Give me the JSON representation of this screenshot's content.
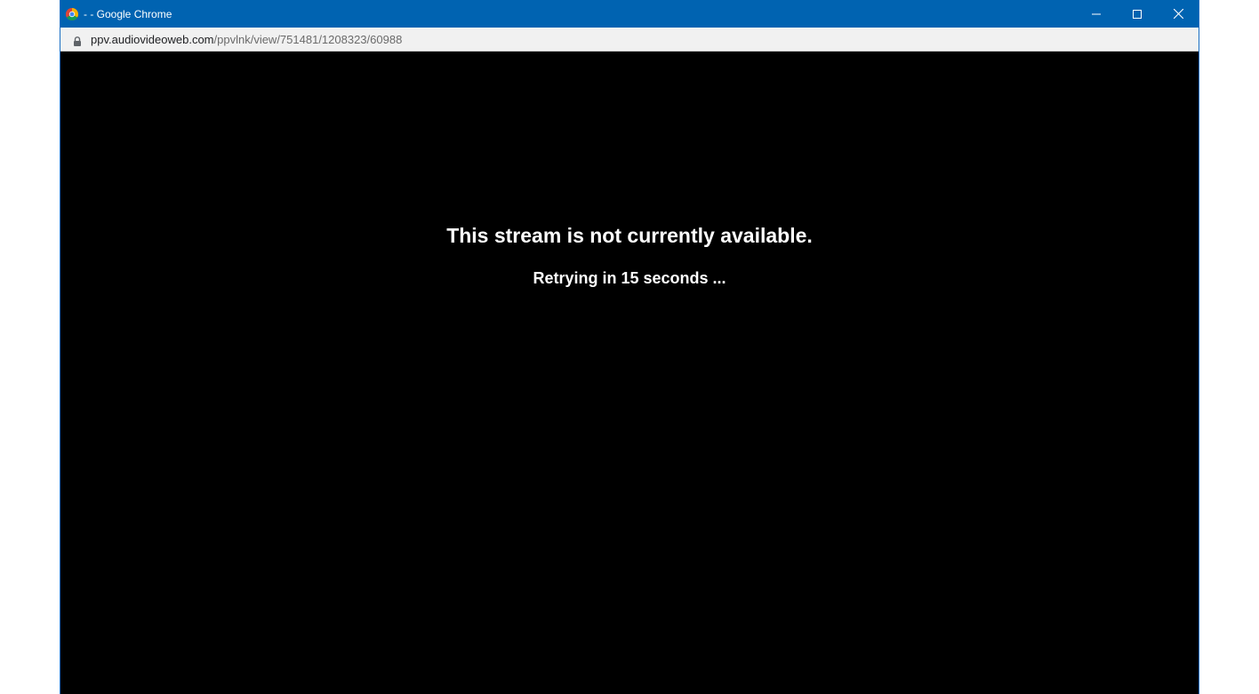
{
  "window": {
    "title": "- - Google Chrome",
    "app_icon": "chrome-icon",
    "controls": {
      "minimize_icon": "minimize-icon",
      "maximize_icon": "maximize-icon",
      "close_icon": "close-icon"
    }
  },
  "addressbar": {
    "lock_icon": "lock-icon",
    "url_host": "ppv.audiovideoweb.com",
    "url_path": "/ppvlnk/view/751481/1208323/60988"
  },
  "content": {
    "message": "This stream is not currently available.",
    "retry_text": "Retrying in 15 seconds ..."
  },
  "colors": {
    "titlebar": "#0063b1",
    "content_bg": "#000000",
    "text": "#ffffff"
  }
}
